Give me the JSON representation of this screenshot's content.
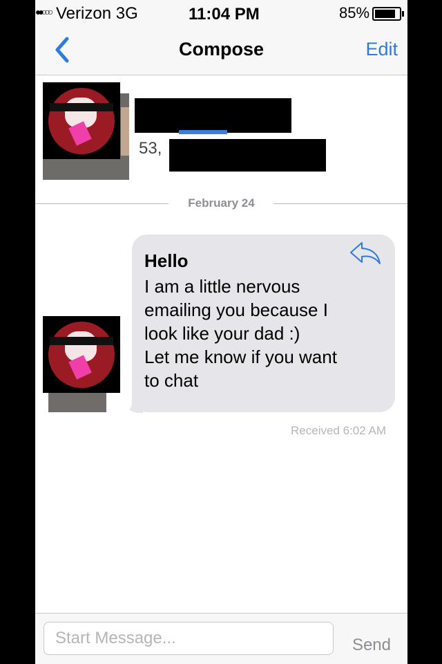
{
  "status_bar": {
    "carrier": "Verizon",
    "network": "3G",
    "time": "11:04 PM",
    "battery_percent": "85%",
    "battery_level": 0.85
  },
  "nav": {
    "back_icon": "chevron-left-icon",
    "title": "Compose",
    "edit_label": "Edit"
  },
  "contact": {
    "age_prefix": "53,"
  },
  "thread": {
    "date_label": "February 24",
    "message": {
      "subject": "Hello",
      "body": "I am a little nervous\nemailing you because I\nlook like your dad :)\nLet me know if you want\nto chat",
      "reply_icon": "reply-arrow-icon",
      "received": "Received 6:02 AM"
    }
  },
  "compose": {
    "placeholder": "Start Message...",
    "send_label": "Send"
  },
  "colors": {
    "accent": "#2f7bd9",
    "bubble": "#e5e5ea",
    "redaction": "#000000"
  }
}
